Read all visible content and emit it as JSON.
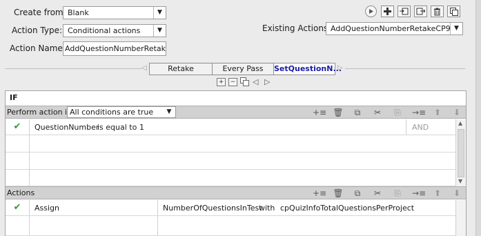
{
  "form": {
    "create_from_label": "Create from:",
    "create_from_value": "Blank",
    "action_type_label": "Action Type:",
    "action_type_value": "Conditional actions",
    "action_name_label": "Action Name:",
    "action_name_value": "AddQuestionNumberRetakeCF",
    "existing_actions_label": "Existing Actions:",
    "existing_actions_value": "AddQuestionNumberRetakeCP9"
  },
  "tabs": [
    {
      "label": "Retake"
    },
    {
      "label": "Every Pass"
    },
    {
      "label": "SetQuestionN..."
    }
  ],
  "if_section": {
    "title": "IF",
    "perform_label": "Perform action if:",
    "perform_value": "All conditions are true",
    "conditions": [
      {
        "left": "QuestionNumber",
        "op": "is equal to",
        "right": "1",
        "logic": "AND"
      }
    ]
  },
  "actions_section": {
    "title": "Actions",
    "rows": [
      {
        "command": "Assign",
        "target": "NumberOfQuestionsInTest",
        "with_label": "with",
        "value": "cpQuizInfoTotalQuestionsPerProject"
      }
    ]
  },
  "icons": {
    "toolbar": [
      "play-icon",
      "add-icon",
      "import-icon",
      "export-icon",
      "delete-icon",
      "duplicate-icon"
    ],
    "grid_toolbar": [
      "insert-row-icon",
      "delete-icon",
      "copy-icon",
      "cut-icon",
      "paste-icon",
      "insert-below-icon",
      "move-up-icon",
      "move-down-icon"
    ]
  },
  "colors": {
    "active_tab_text": "#1a1aa6",
    "check": "#2f9a2f"
  }
}
